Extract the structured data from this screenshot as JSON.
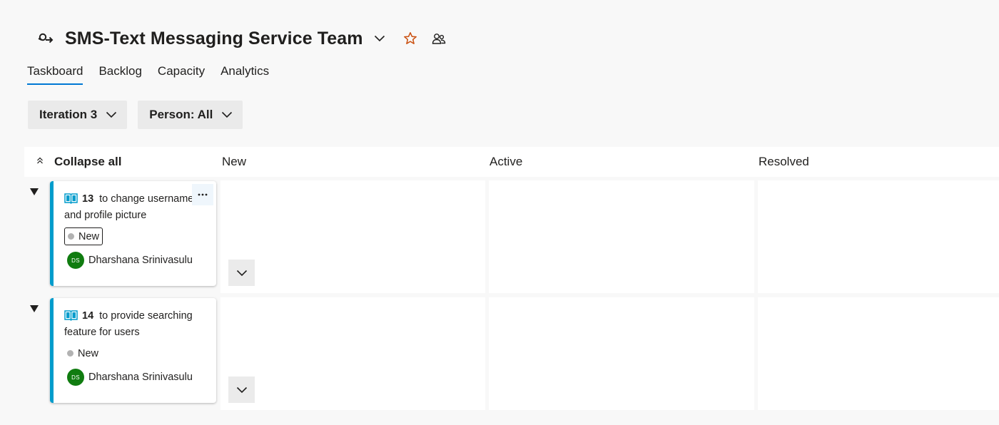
{
  "team": {
    "name": "SMS-Text Messaging Service Team",
    "icon": "team-icon",
    "favorite_color": "#ca5010"
  },
  "tabs": [
    {
      "label": "Taskboard",
      "selected": true
    },
    {
      "label": "Backlog",
      "selected": false
    },
    {
      "label": "Capacity",
      "selected": false
    },
    {
      "label": "Analytics",
      "selected": false
    }
  ],
  "filters": {
    "iteration": "Iteration 3",
    "person": "Person: All"
  },
  "board": {
    "collapse_all": "Collapse all",
    "columns": [
      "New",
      "Active",
      "Resolved"
    ],
    "rows": [
      {
        "id": "13",
        "title": "to change username and profile picture",
        "state": "New",
        "assignee": "Dharshana Srinivasulu",
        "initials": "DS"
      },
      {
        "id": "14",
        "title": "to provide searching feature for users",
        "state": "New",
        "assignee": "Dharshana Srinivasulu",
        "initials": "DS"
      }
    ]
  },
  "colors": {
    "accent": "#0078d4",
    "card_bar": "#009ccc",
    "avatar": "#107c10",
    "state_new": "#b2b2b2"
  }
}
